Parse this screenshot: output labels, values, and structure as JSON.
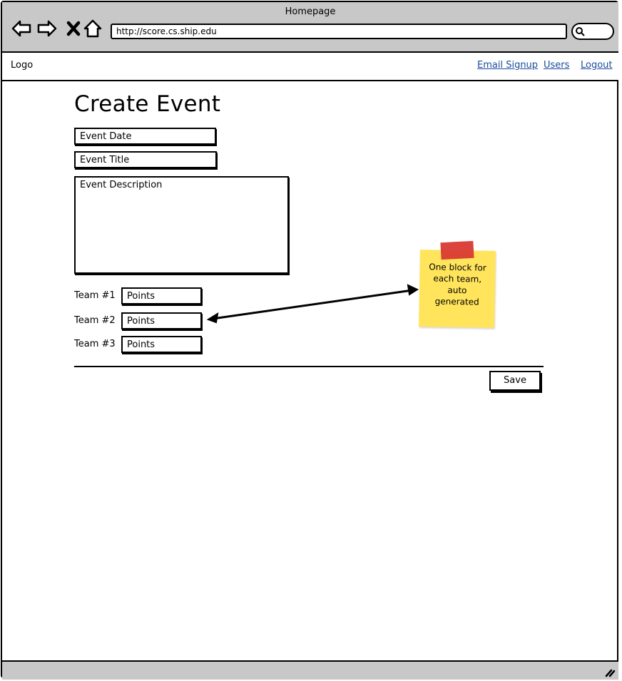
{
  "window": {
    "title": "Homepage"
  },
  "browser": {
    "url": "http://score.cs.ship.edu"
  },
  "header": {
    "logo": "Logo",
    "links": [
      "Email Signup",
      "Users",
      "Logout"
    ]
  },
  "form": {
    "title": "Create Event",
    "event_date_placeholder": "Event Date",
    "event_title_placeholder": "Event Title",
    "event_description_placeholder": "Event Description",
    "teams": [
      {
        "label": "Team #1",
        "points_placeholder": "Points"
      },
      {
        "label": "Team #2",
        "points_placeholder": "Points"
      },
      {
        "label": "Team #3",
        "points_placeholder": "Points"
      }
    ],
    "save_label": "Save"
  },
  "annotation": {
    "note_line1": "One block for",
    "note_line2": "each team,",
    "note_line3": "auto",
    "note_line4": "generated"
  },
  "colors": {
    "chrome": "#c8c8c8",
    "link": "#1a4a9c",
    "sticky": "#ffe45c",
    "tape": "#d93a32"
  },
  "icons": [
    "back-icon",
    "forward-icon",
    "close-icon",
    "home-icon",
    "search-icon",
    "resize-grip-icon"
  ]
}
